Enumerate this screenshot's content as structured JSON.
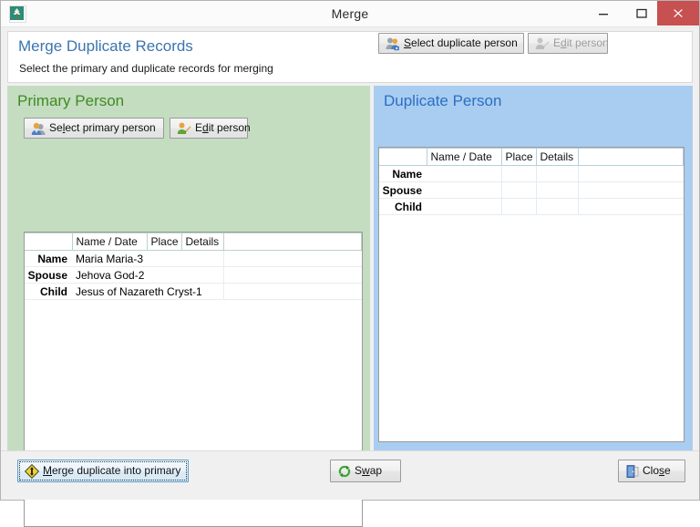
{
  "window": {
    "title": "Merge",
    "app_icon": "family-tree-icon",
    "controls": {
      "minimize": "minimize-icon",
      "maximize": "maximize-icon",
      "close": "close-icon",
      "close_color": "#c75050"
    }
  },
  "header": {
    "title": "Merge Duplicate Records",
    "subtitle": "Select the primary and duplicate records for merging",
    "title_color": "#3b75ad"
  },
  "primary_panel": {
    "title": "Primary Person",
    "title_color": "#3f8b21",
    "background": "#c4ddc1",
    "select_button": {
      "label": "Select primary person",
      "accel": "l",
      "icon": "two-people-icon",
      "enabled": true
    },
    "edit_button": {
      "label": "Edit person",
      "accel": "d",
      "icon": "person-edit-icon",
      "enabled": true
    },
    "table": {
      "columns": [
        "",
        "Name / Date",
        "Place",
        "Details",
        ""
      ],
      "rows": [
        {
          "label": "Name",
          "value": "Maria Maria-3"
        },
        {
          "label": "Spouse",
          "value": "Jehova God-2"
        },
        {
          "label": "Child",
          "value": "Jesus of Nazareth Cryst-1"
        }
      ]
    }
  },
  "duplicate_panel": {
    "title": "Duplicate Person",
    "title_color": "#2b6fc4",
    "background": "#a9cdf0",
    "select_button": {
      "label": "Select duplicate person",
      "accel": "S",
      "icon": "two-people-add-icon",
      "enabled": true
    },
    "edit_button": {
      "label": "Edit person",
      "accel": "d",
      "icon": "person-edit-icon",
      "enabled": false
    },
    "table": {
      "columns": [
        "",
        "Name / Date",
        "Place",
        "Details",
        ""
      ],
      "rows": [
        {
          "label": "Name",
          "value": ""
        },
        {
          "label": "Spouse",
          "value": ""
        },
        {
          "label": "Child",
          "value": ""
        }
      ]
    }
  },
  "footer": {
    "merge_button": {
      "label": "Merge duplicate into primary",
      "accel": "M",
      "icon": "merge-arrows-diamond-icon",
      "focused": true
    },
    "swap_button": {
      "label": "Swap",
      "accel": "w",
      "icon": "swap-recycle-icon"
    },
    "close_button": {
      "label": "Close",
      "accel": "s",
      "icon": "door-exit-icon"
    }
  }
}
